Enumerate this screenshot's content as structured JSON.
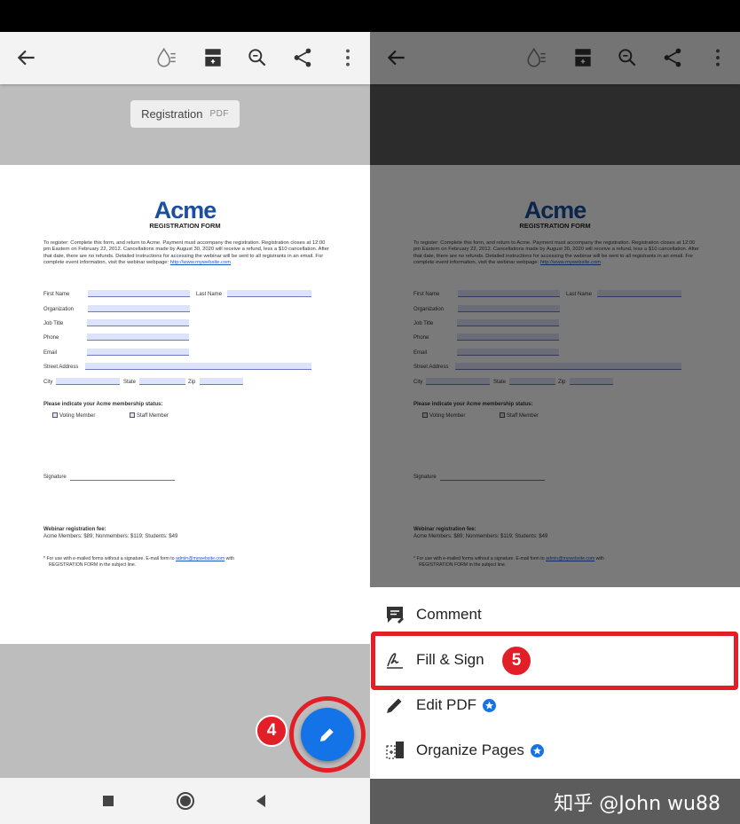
{
  "document": {
    "tab_name": "Registration",
    "tab_type": "PDF",
    "logo": "Acme",
    "form_title": "REGISTRATION FORM",
    "intro": "To register: Complete this form, and return to Acme. Payment must accompany the registration. Registration closes at 12:00 pm Eastern on February 22, 2012. Cancellations made by August 30, 2020 will receive a refund, less a $10 cancellation. After that date, there are no refunds. Detailed instructions for accessing the webinar will be sent to all registrants in an email. For complete event information, visit the webinar webpage:",
    "intro_link": "http://www.mywebsite.com",
    "fields": {
      "first_name": "First Name",
      "last_name": "Last Name",
      "organization": "Organization",
      "job_title": "Job Title",
      "phone": "Phone",
      "email": "Email",
      "street_address": "Street Address",
      "city": "City",
      "state": "State",
      "zip": "Zip"
    },
    "membership_heading": "Please indicate your Acme membership status:",
    "membership_options": [
      "Voting Member",
      "Staff Member"
    ],
    "signature": "Signature",
    "fee_heading": "Webinar registration fee:",
    "fee_text": "Acme Members: $89; Nonmembers: $119; Students: $49",
    "footnote_pre": "* For use with e-mailed forms without a signature. E-mail form to",
    "footnote_link": "admin@mywebsite.com",
    "footnote_post": "with",
    "footnote_line2": "REGISTRATION FORM in the subject line."
  },
  "badges": {
    "fab_step": "4",
    "menu_step": "5"
  },
  "menu": {
    "comment": "Comment",
    "fill_sign": "Fill & Sign",
    "edit_pdf": "Edit PDF",
    "organize_pages": "Organize Pages"
  },
  "watermark": "知乎 @John wu88",
  "icons": {
    "back": "arrow-left-icon",
    "reading_mode": "droplet-lines-icon",
    "page_view": "document-layout-icon",
    "search": "magnifier-icon",
    "share": "share-icon",
    "more": "more-vertical-icon",
    "fab": "pencil-icon",
    "nav_recents": "square-icon",
    "nav_home": "circle-icon",
    "nav_back": "triangle-back-icon",
    "comment": "speech-bubble-icon",
    "fill_sign": "pen-sign-icon",
    "edit_pdf": "pencil-icon",
    "organize_pages": "pages-icon",
    "premium": "star-badge-icon"
  },
  "colors": {
    "accent": "#1473e6",
    "highlight": "#e21f26",
    "logo": "#1b4f9c"
  }
}
